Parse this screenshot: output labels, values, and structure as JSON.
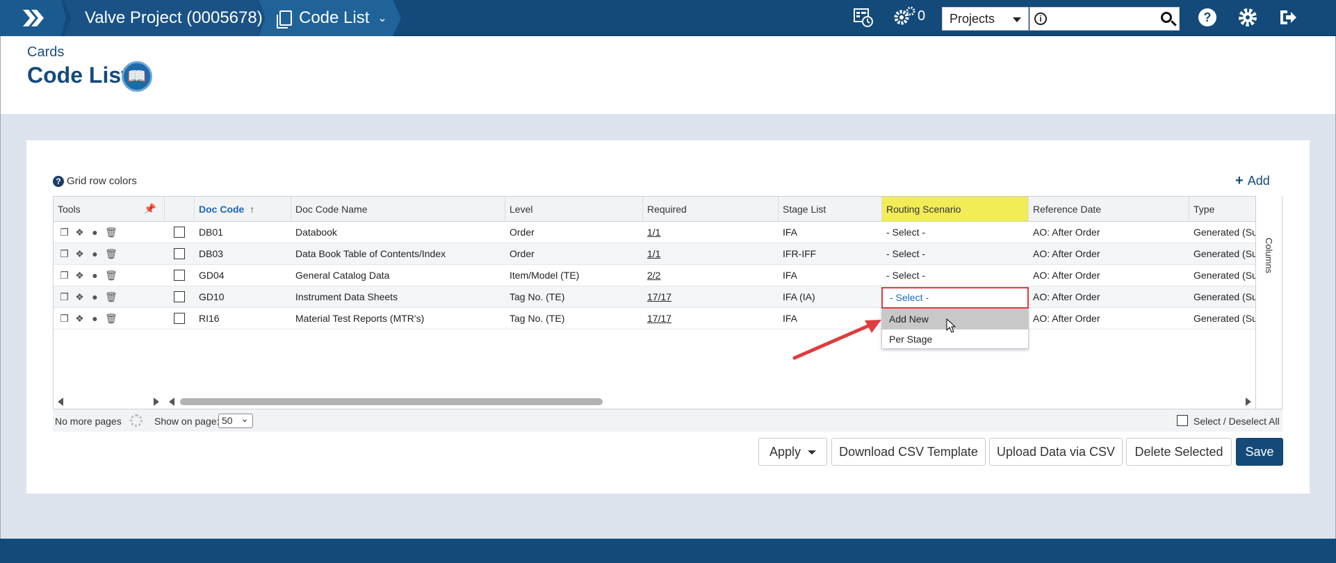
{
  "nav": {
    "project": "Valve Project (0005678)",
    "codelist": "Code List",
    "gear_count": "0",
    "projects_select": "Projects",
    "search_placeholder": ""
  },
  "header": {
    "breadcrumb": "Cards",
    "title": "Code List"
  },
  "toolbar": {
    "grid_colors": "Grid row colors",
    "add": "Add"
  },
  "grid": {
    "columns": {
      "tools": "Tools",
      "doc_code": "Doc Code",
      "doc_code_name": "Doc Code Name",
      "level": "Level",
      "required": "Required",
      "stage_list": "Stage List",
      "routing": "Routing Scenario",
      "reference_date": "Reference Date",
      "type": "Type"
    },
    "rows": [
      {
        "code": "DB01",
        "name": "Databook",
        "level": "Order",
        "required": "1/1",
        "stage": "IFA",
        "routing": "- Select -",
        "ref": "AO: After Order",
        "type": "Generated (Sub"
      },
      {
        "code": "DB03",
        "name": "Data Book Table of Contents/Index",
        "level": "Order",
        "required": "1/1",
        "stage": "IFR-IFF",
        "routing": "- Select -",
        "ref": "AO: After Order",
        "type": "Generated (Sub"
      },
      {
        "code": "GD04",
        "name": "General Catalog Data",
        "level": "Item/Model (TE)",
        "required": "2/2",
        "stage": "IFA",
        "routing": "- Select -",
        "ref": "AO: After Order",
        "type": "Generated (Sub"
      },
      {
        "code": "GD10",
        "name": "Instrument Data Sheets",
        "level": "Tag No. (TE)",
        "required": "17/17",
        "stage": "IFA (IA)",
        "routing": "- Select -",
        "ref": "AO: After Order",
        "type": "Generated (Sub"
      },
      {
        "code": "RI16",
        "name": "Material Test Reports (MTR's)",
        "level": "Tag No. (TE)",
        "required": "17/17",
        "stage": "IFA",
        "routing": "",
        "ref": "AO: After Order",
        "type": "Generated (Sub"
      }
    ],
    "dropdown_options": [
      "Add New",
      "Per Stage"
    ],
    "columns_tab": "Columns"
  },
  "pager": {
    "no_more": "No more pages",
    "show_on_page": "Show on page:",
    "page_size": "50",
    "select_all": "Select / Deselect All"
  },
  "buttons": {
    "apply": "Apply",
    "download": "Download CSV Template",
    "upload": "Upload Data via CSV",
    "delete": "Delete Selected",
    "save": "Save"
  }
}
